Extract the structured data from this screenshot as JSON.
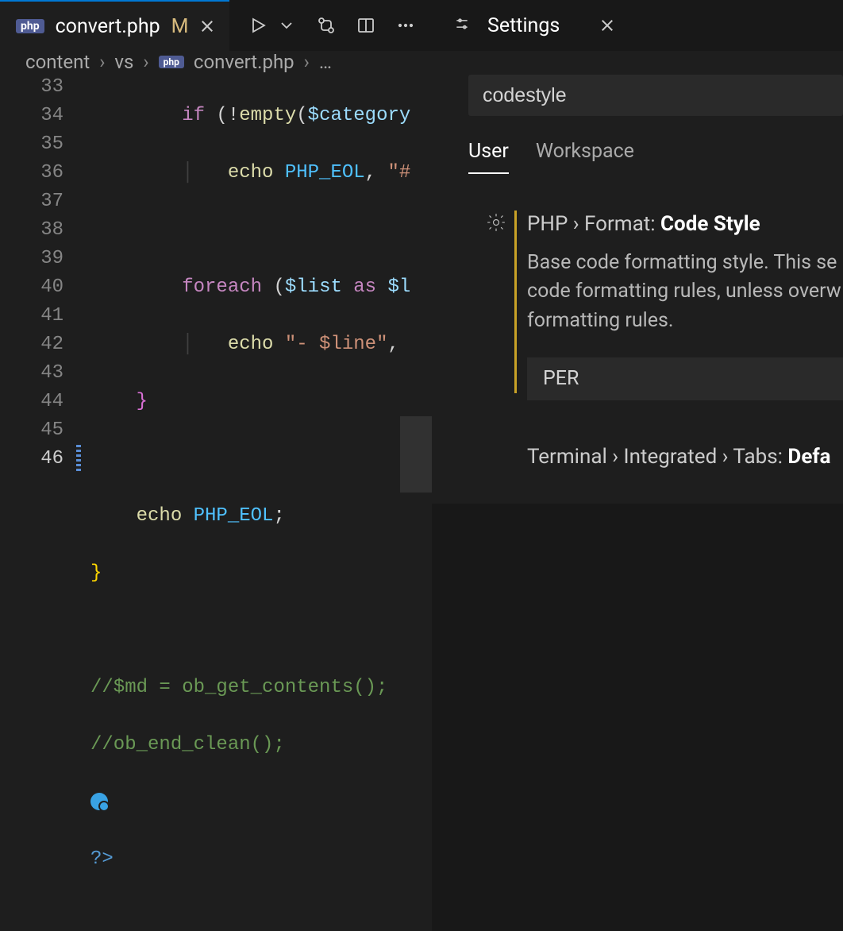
{
  "editor": {
    "tab": {
      "badge": "php",
      "title": "convert.php",
      "modified": "M"
    },
    "breadcrumbs": {
      "parts": [
        "content",
        "vs",
        "convert.php"
      ],
      "badge": "php",
      "trailing": "…"
    },
    "lineStart": 33,
    "lineCount": 14,
    "code": {
      "l33": {
        "kw": "if",
        "op1": " (!",
        "fn": "empty",
        "op2": "(",
        "var": "$category",
        "tail": ""
      },
      "l34": {
        "echo": "echo",
        "con": "PHP_EOL",
        "comma": ", ",
        "str": "\"#"
      },
      "l36": {
        "kw": "foreach",
        "op1": " (",
        "var1": "$list",
        "as": " as ",
        "var2": "$l",
        "tail": ""
      },
      "l37": {
        "echo": "echo",
        "str": "\"- $line\"",
        "comma": ", "
      },
      "l38": {
        "brace": "}"
      },
      "l40": {
        "echo": "echo",
        "con": "PHP_EOL",
        "semi": ";"
      },
      "l41": {
        "brace": "}"
      },
      "l43": "//$md = ob_get_contents();",
      "l44": "//ob_end_clean();",
      "l46": "?>"
    }
  },
  "settings": {
    "title": "Settings",
    "search": "codestyle",
    "scopes": {
      "user": "User",
      "workspace": "Workspace"
    },
    "item1": {
      "breadcrumb": "PHP › Format:",
      "name": "Code Style",
      "description": "Base code formatting style. This se code formatting rules, unless overw formatting rules.",
      "value": "PER"
    },
    "item2": {
      "breadcrumb": "Terminal › Integrated › Tabs:",
      "name": "Defa"
    }
  }
}
